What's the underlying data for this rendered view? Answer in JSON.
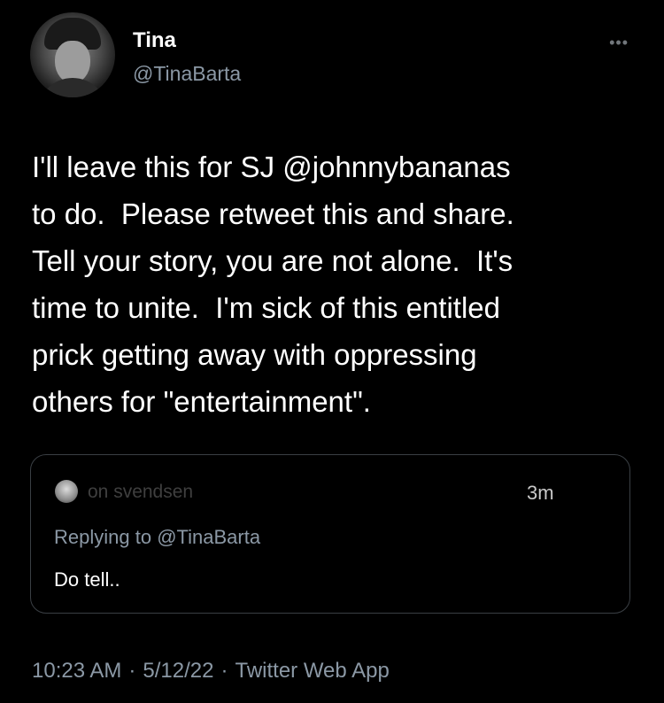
{
  "author": {
    "name": "Tina",
    "handle": "@TinaBarta"
  },
  "more_icon": "more-dots-icon",
  "tweet": {
    "text_before_mention": "I'll leave this for SJ ",
    "mention": "@johnnybananas",
    "text_after_mention": "\nto do.  Please retweet this and share.\nTell your story, you are not alone.  It's\ntime to unite.  I'm sick of this entitled\nprick getting away with oppressing\nothers for \"entertainment\"."
  },
  "quoted": {
    "name_partial": "on svendsen",
    "time": "3m",
    "replying_prefix": "Replying to ",
    "replying_handle": "@TinaBarta",
    "text": "Do tell.."
  },
  "meta": {
    "time": "10:23 AM",
    "date": "5/12/22",
    "separator": "·",
    "source": "Twitter Web App"
  },
  "colors": {
    "background": "#000000",
    "text": "#ffffff",
    "secondary": "#8b98a5",
    "border": "#3a3f44"
  }
}
